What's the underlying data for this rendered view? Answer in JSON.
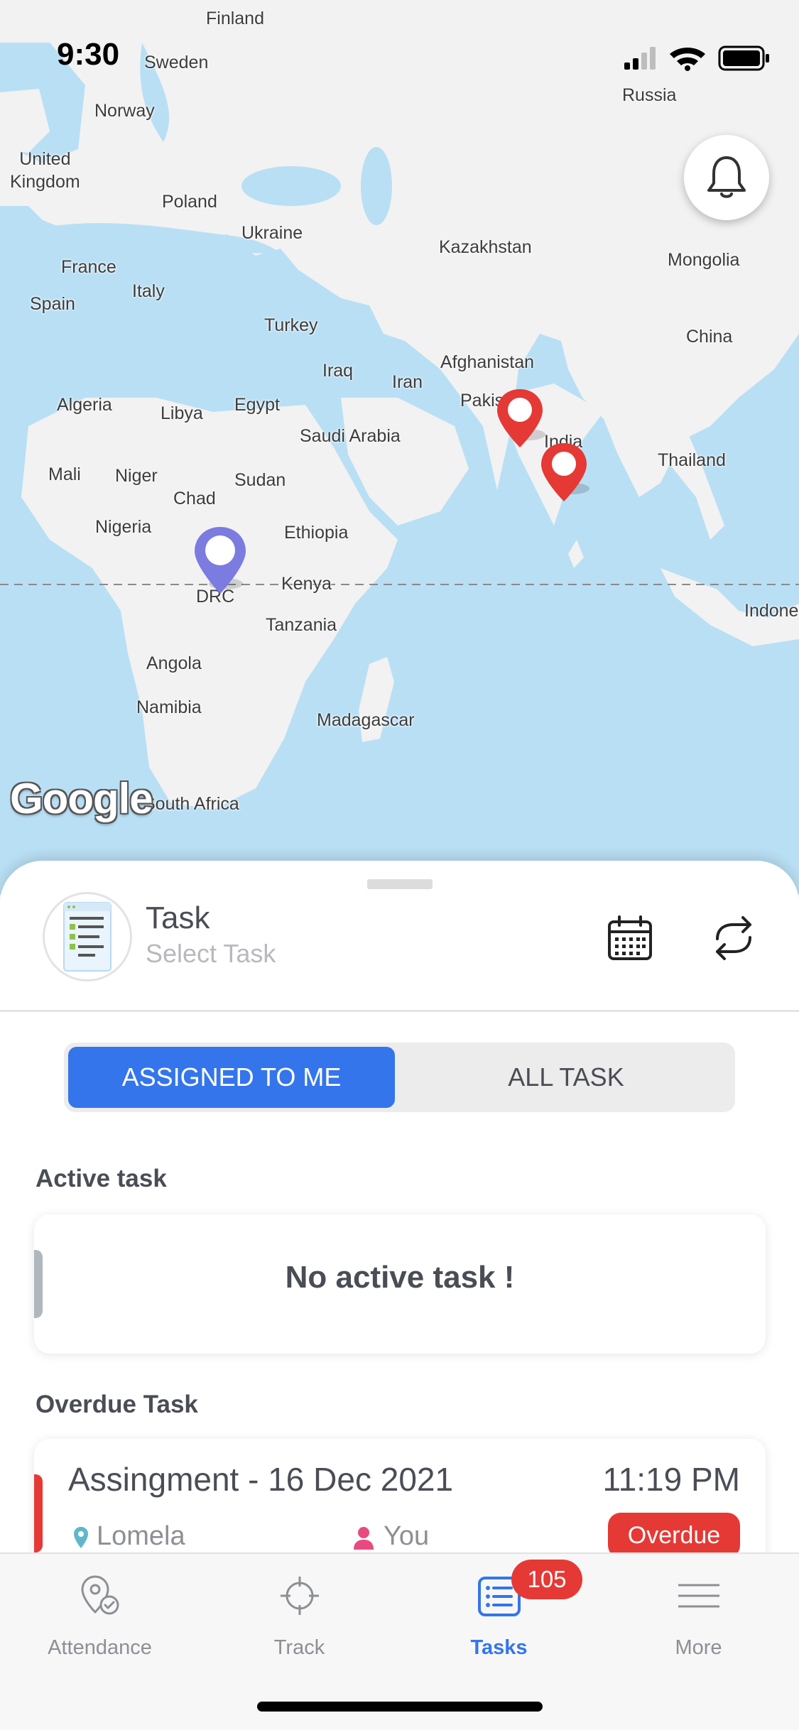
{
  "status_bar": {
    "time": "9:30"
  },
  "map": {
    "labels": {
      "finland": "Finland",
      "sweden": "Sweden",
      "norway": "Norway",
      "russia": "Russia",
      "united_kingdom": "United\nKingdom",
      "poland": "Poland",
      "ukraine": "Ukraine",
      "kazakhstan": "Kazakhstan",
      "mongolia": "Mongolia",
      "france": "France",
      "italy": "Italy",
      "spain": "Spain",
      "turkey": "Turkey",
      "china": "China",
      "afghanistan": "Afghanistan",
      "iraq": "Iraq",
      "iran": "Iran",
      "pakistan": "Pakis",
      "algeria": "Algeria",
      "libya": "Libya",
      "egypt": "Egypt",
      "saudi_arabia": "Saudi Arabia",
      "india": "India",
      "thailand": "Thailand",
      "mali": "Mali",
      "niger": "Niger",
      "chad": "Chad",
      "sudan": "Sudan",
      "nigeria": "Nigeria",
      "ethiopia": "Ethiopia",
      "drc": "DRC",
      "kenya": "Kenya",
      "indonesia": "Indone",
      "tanzania": "Tanzania",
      "angola": "Angola",
      "namibia": "Namibia",
      "madagascar": "Madagascar",
      "south_africa": "South Africa"
    },
    "attribution": "Google",
    "colors": {
      "water": "#b9dff4",
      "land": "#f2f2f2",
      "pin_red": "#e53935",
      "pin_purple": "#7b7be0"
    },
    "notification_icon": "bell-icon"
  },
  "sheet": {
    "title": "Task",
    "subtitle": "Select Task",
    "segments": {
      "assigned": "ASSIGNED TO ME",
      "all": "ALL TASK"
    },
    "active_section": {
      "title": "Active task",
      "empty_text": "No active task !"
    },
    "overdue_section": {
      "title": "Overdue Task",
      "items": [
        {
          "title": "Assingment - 16 Dec 2021",
          "time": "11:19 PM",
          "location": "Lomela",
          "assignee": "You",
          "status": "Overdue"
        }
      ]
    }
  },
  "tabbar": {
    "tabs": [
      {
        "label": "Attendance",
        "icon": "location-check-icon"
      },
      {
        "label": "Track",
        "icon": "crosshair-icon"
      },
      {
        "label": "Tasks",
        "icon": "task-list-icon",
        "badge": "105",
        "active": true
      },
      {
        "label": "More",
        "icon": "menu-icon"
      }
    ]
  },
  "theme": {
    "accent": "#3475ec",
    "danger": "#e53935",
    "text": "#4a4d55",
    "muted": "#8c8f94"
  }
}
